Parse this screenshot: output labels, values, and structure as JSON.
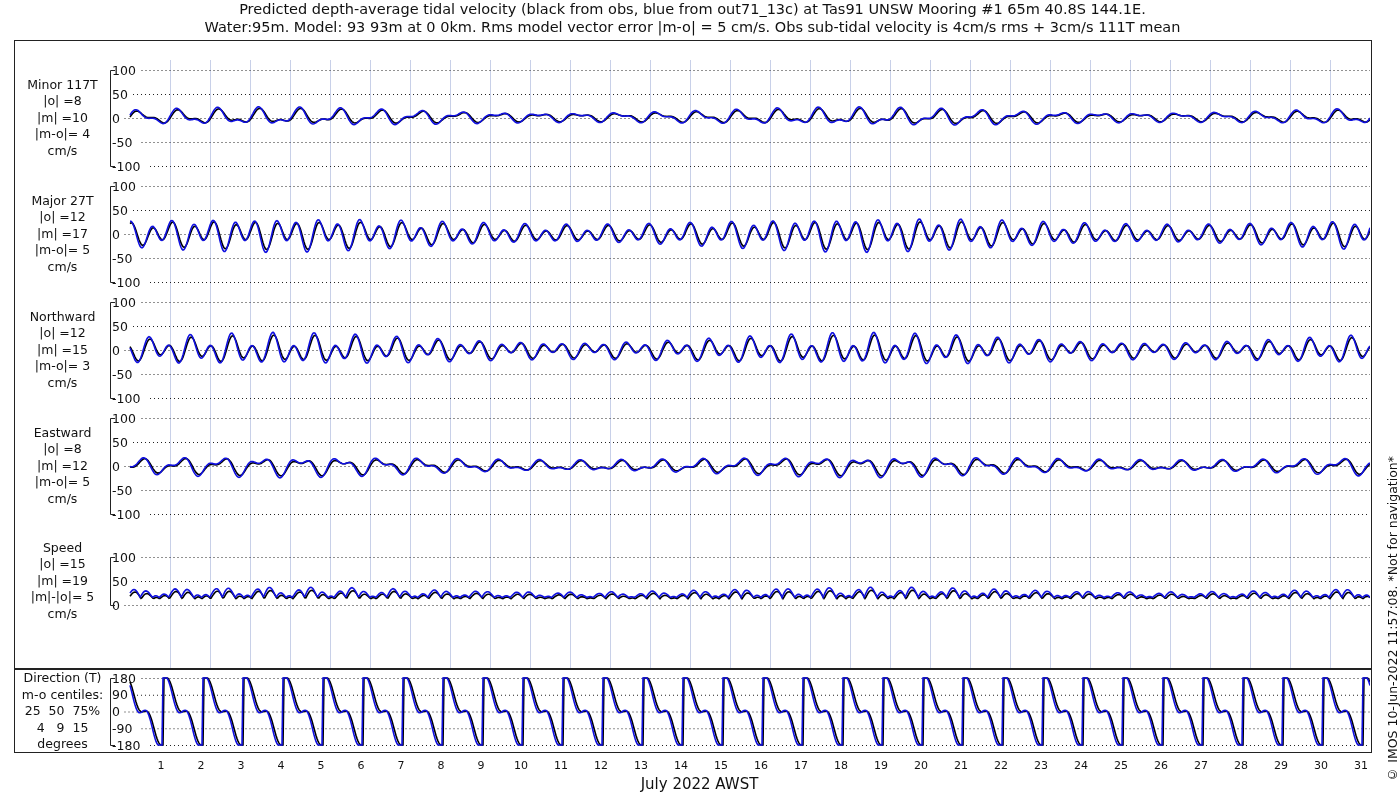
{
  "title_lines": [
    "Predicted depth-average tidal velocity (black from obs, blue from out71_13c) at Tas91 UNSW Mooring #1 65m 40.8S 144.1E.",
    "Water:95m. Model: 93 93m at 0 0km. Rms model vector error |m-o| = 5 cm/s. Obs sub-tidal velocity is 4cm/s rms + 3cm/s 111T mean"
  ],
  "panels": [
    {
      "kind": "signed",
      "label_lines": [
        "Minor 117T",
        "|o| =8",
        "|m| =10",
        "|m-o|= 4",
        "cm/s"
      ],
      "yticks": [
        "100",
        "50",
        "0",
        "-50",
        "-100"
      ]
    },
    {
      "kind": "signed",
      "label_lines": [
        "Major 27T",
        "|o| =12",
        "|m| =17",
        "|m-o|= 5",
        "cm/s"
      ],
      "yticks": [
        "100",
        "50",
        "0",
        "-50",
        "-100"
      ]
    },
    {
      "kind": "signed",
      "label_lines": [
        "Northward",
        "|o| =12",
        "|m| =15",
        "|m-o|= 3",
        "cm/s"
      ],
      "yticks": [
        "100",
        "50",
        "0",
        "-50",
        "-100"
      ]
    },
    {
      "kind": "signed",
      "label_lines": [
        "Eastward",
        "|o| =8",
        "|m| =12",
        "|m-o|= 5",
        "cm/s"
      ],
      "yticks": [
        "100",
        "50",
        "0",
        "-50",
        "-100"
      ]
    },
    {
      "kind": "speed",
      "label_lines": [
        "Speed",
        "|o| =15",
        "|m| =19",
        "|m|-|o|= 5",
        "cm/s"
      ],
      "yticks": [
        "100",
        "50",
        "0"
      ]
    },
    {
      "kind": "direction",
      "label_lines": [
        "Direction (T)",
        "m-o centiles:",
        "25  50  75%",
        "4   9  15",
        "degrees"
      ],
      "yticks": [
        "180",
        "90",
        "0",
        "-90",
        "-180"
      ]
    }
  ],
  "x_ticks": [
    "1",
    "2",
    "3",
    "4",
    "5",
    "6",
    "7",
    "8",
    "9",
    "10",
    "11",
    "12",
    "13",
    "14",
    "15",
    "16",
    "17",
    "18",
    "19",
    "20",
    "21",
    "22",
    "23",
    "24",
    "25",
    "26",
    "27",
    "28",
    "29",
    "30",
    "31"
  ],
  "xlabel": "July 2022 AWST",
  "credit": "© IMOS 10-Jun-2022 11:57:08. *Not for navigation*"
}
